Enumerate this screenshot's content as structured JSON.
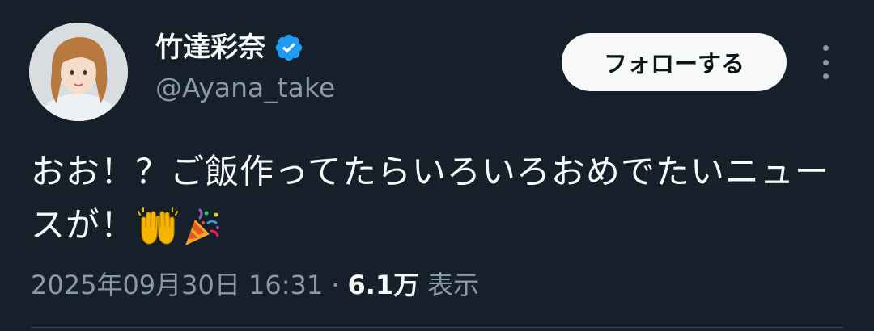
{
  "author": {
    "display_name": "竹達彩奈",
    "handle": "@Ayana_take",
    "verified_icon": "verified-badge-icon",
    "avatar_icon": "profile-avatar"
  },
  "actions": {
    "follow_label": "フォローする",
    "more_icon": "more-vertical-icon"
  },
  "tweet": {
    "text": "おお！？ご飯作ってたらいろいろおめでたいニュースが！",
    "emojis": [
      "raising-hands-emoji",
      "party-popper-emoji"
    ]
  },
  "meta": {
    "timestamp": "2025年09月30日 16:31",
    "separator": "·",
    "views_count": "6.1万",
    "views_label": "表示"
  },
  "colors": {
    "background": "#15202b",
    "primary_text": "#f7f9f9",
    "secondary_text": "#8b98a5",
    "verified_blue": "#1d9bf0",
    "button_bg": "#f7f9f9"
  }
}
